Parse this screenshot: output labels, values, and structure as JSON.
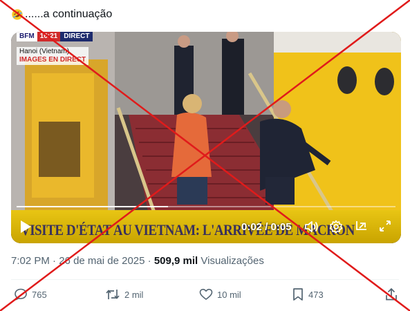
{
  "tweet": {
    "text": "......a continuação",
    "emoji": "rolling-on-floor-laughing-emoji"
  },
  "video": {
    "channel_logo": "BFM",
    "clock": "16:21",
    "live_tag": "DIRECT",
    "location": "Hanoi (Vietnam)",
    "live_label": "IMAGES EN DIRECT",
    "ticker": "VISITE D'ÉTAT AU VIETNAM: L'ARRIVÉE DE MACRON",
    "time_current": "0:02",
    "time_separator": " / ",
    "time_total": "0:05",
    "progress_fraction": 0.4
  },
  "meta": {
    "time": "7:02 PM",
    "sep1": " · ",
    "date": "26 de mai de 2025",
    "sep2": " · ",
    "views_count": "509,9 mil",
    "views_label": " Visualizações"
  },
  "actions": {
    "replies": "765",
    "reposts": "2 mil",
    "likes": "10 mil",
    "bookmarks": "473"
  },
  "colors": {
    "fact_check_cross": "#e01b1b",
    "ticker_bg": "#e8c514",
    "muted_text": "#536471"
  }
}
